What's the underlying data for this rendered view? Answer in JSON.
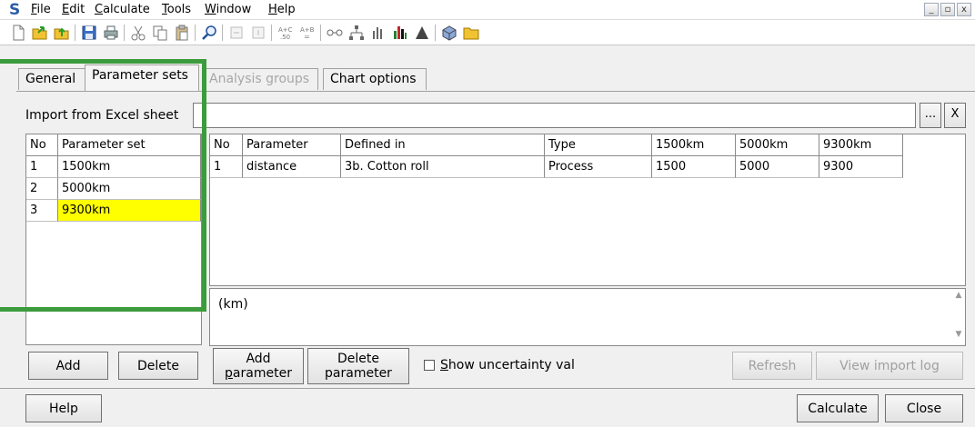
{
  "menu": {
    "logo": "S",
    "items": [
      "File",
      "Edit",
      "Calculate",
      "Tools",
      "Window",
      "Help"
    ]
  },
  "window_controls": [
    "_",
    "▫",
    "x"
  ],
  "toolbar": {
    "icons": [
      "new-file-icon",
      "open-folder-icon",
      "upload-folder-icon",
      "save-icon",
      "print-icon",
      "cut-icon",
      "copy-icon",
      "paste-icon",
      "search-icon",
      "insert-left-icon",
      "insert-right-icon",
      "formula-icon",
      "equal-icon",
      "network-icon",
      "tree-icon",
      "bar-chart-icon",
      "colored-bar-chart-icon",
      "histogram-icon",
      "box-icon",
      "folder-icon"
    ]
  },
  "tabs": [
    {
      "label": "General",
      "state": "normal"
    },
    {
      "label": "Parameter sets",
      "state": "active"
    },
    {
      "label": "Analysis groups",
      "state": "disabled"
    },
    {
      "label": "Chart options",
      "state": "normal"
    }
  ],
  "import": {
    "label": "Import from Excel sheet",
    "value": "",
    "browse_label": "...",
    "clear_label": "X"
  },
  "left_grid": {
    "headers": [
      "No",
      "Parameter set"
    ],
    "rows": [
      [
        "1",
        "1500km"
      ],
      [
        "2",
        "5000km"
      ],
      [
        "3",
        "9300km"
      ]
    ],
    "selected_row": 3
  },
  "right_grid": {
    "headers": [
      "No",
      "Parameter",
      "Defined in",
      "Type",
      "1500km",
      "5000km",
      "9300km"
    ],
    "rows": [
      [
        "1",
        "distance",
        "3b. Cotton roll",
        "Process",
        "1500",
        "5000",
        "9300"
      ]
    ]
  },
  "note": "(km)",
  "buttons": {
    "add": "Add",
    "delete": "Delete",
    "add_parameter": [
      "Add",
      "parameter"
    ],
    "delete_parameter": [
      "Delete",
      "parameter"
    ],
    "show_uncertainty": "Show uncertainty val",
    "refresh": "Refresh",
    "view_import_log": "View import log",
    "help": "Help",
    "calculate": "Calculate",
    "close": "Close"
  },
  "colors": {
    "selection": "#ffff00",
    "highlight": "#3c9b3c"
  }
}
